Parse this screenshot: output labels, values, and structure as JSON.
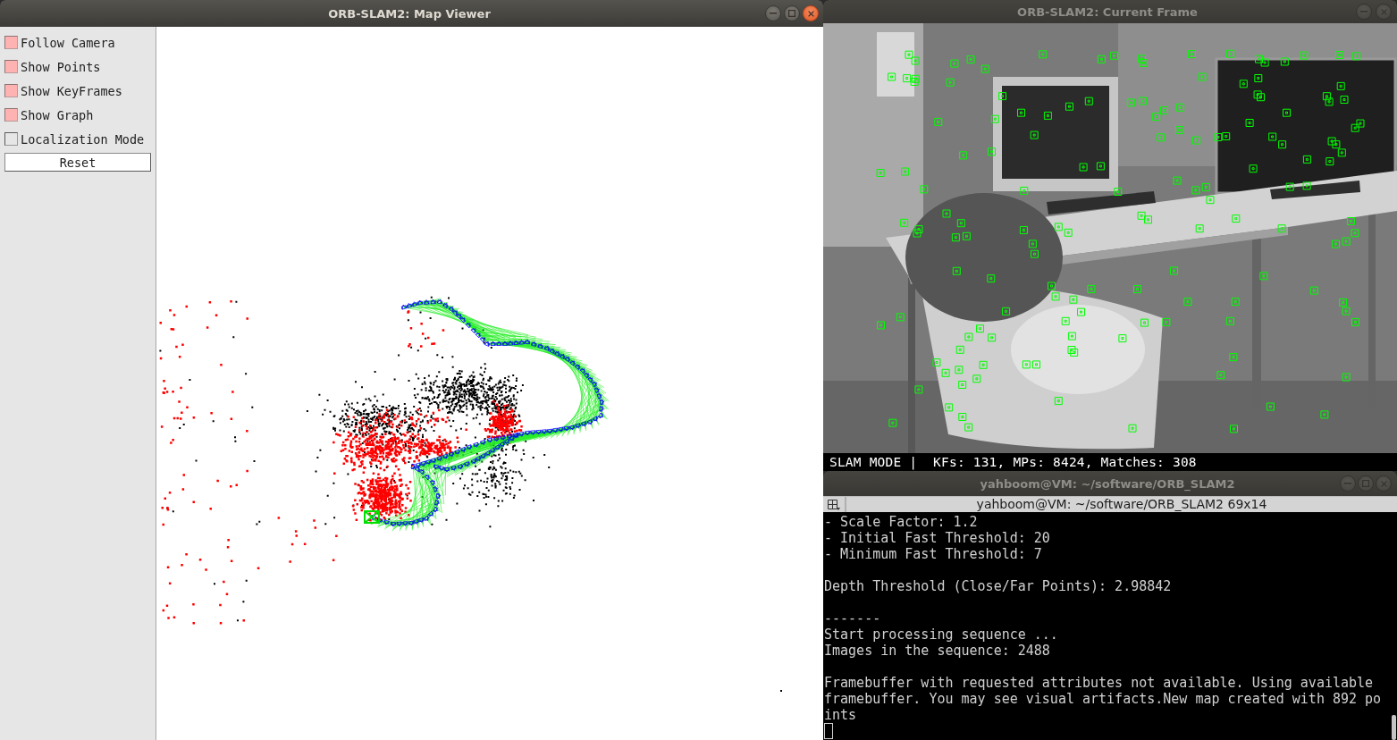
{
  "map_viewer": {
    "title": "ORB-SLAM2: Map Viewer",
    "active": true,
    "maximize_button": true,
    "options": [
      {
        "label": "Follow Camera",
        "checked": true
      },
      {
        "label": "Show Points",
        "checked": true
      },
      {
        "label": "Show KeyFrames",
        "checked": true
      },
      {
        "label": "Show Graph",
        "checked": true
      },
      {
        "label": "Localization Mode",
        "checked": false
      }
    ],
    "reset_button": "Reset"
  },
  "current_frame": {
    "title": "ORB-SLAM2: Current Frame",
    "active": false,
    "status_text": "SLAM MODE |  KFs: 131, MPs: 8424, Matches: 308"
  },
  "terminal": {
    "title": "yahboom@VM: ~/software/ORB_SLAM2",
    "active": false,
    "maximize_button": true,
    "tab_title": "yahboom@VM: ~/software/ORB_SLAM2 69x14",
    "output": [
      [
        "- Scale Factor: 1.2",
        "- Initial Fast Threshold: 20",
        "- Minimum Fast Threshold: 7"
      ],
      [
        "Depth Threshold (Close/Far Points): 2.98842"
      ],
      [
        "-------",
        "Start processing sequence ...",
        "Images in the sequence: 2488"
      ],
      [
        "Framebuffer with requested attributes not available. Using available",
        "framebuffer. You may see visual artifacts.New map created with 892 po",
        "ints"
      ]
    ]
  }
}
